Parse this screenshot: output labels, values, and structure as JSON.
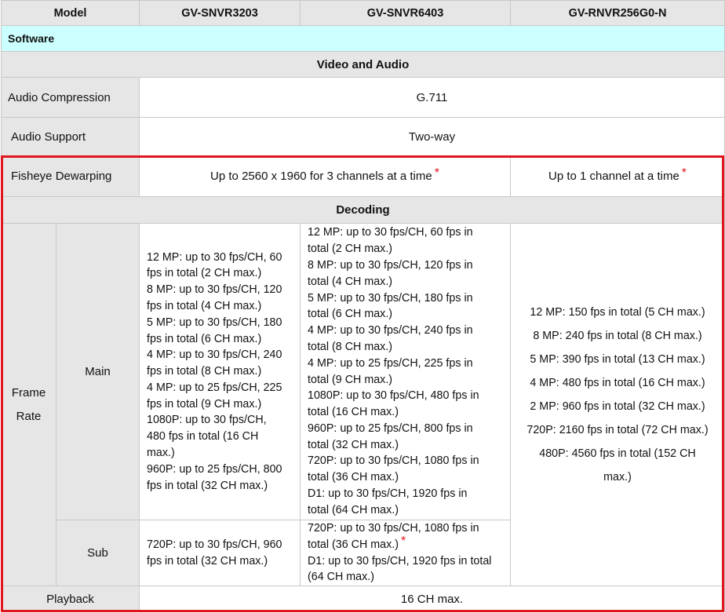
{
  "header": {
    "model": "Model",
    "col1": "GV-SNVR3203",
    "col2": "GV-SNVR6403",
    "col3": "GV-RNVR256G0-N"
  },
  "software": "Software",
  "video_audio": "Video and Audio",
  "audio_compression": {
    "label": "Audio Compression",
    "value": "G.711"
  },
  "audio_support": {
    "label": "Audio Support",
    "value": "Two-way"
  },
  "fisheye": {
    "label": "Fisheye Dewarping",
    "value_12": "Up to 2560 x 1960 for 3 channels at a time",
    "value_3": "Up to 1 channel at a time",
    "mark": "*"
  },
  "decoding": "Decoding",
  "frame_rate": {
    "label_1": "Frame",
    "label_2": "Rate",
    "main_label": "Main",
    "sub_label": "Sub",
    "main_col1": [
      "12 MP: up to 30 fps/CH, 60",
      "fps in total (2 CH max.)",
      "8 MP: up to 30 fps/CH, 120",
      "fps in total (4 CH max.)",
      "5 MP: up to 30 fps/CH, 180",
      "fps in total (6 CH max.)",
      "4 MP: up to 30 fps/CH, 240",
      "fps in total (8 CH max.)",
      "4 MP: up to 25 fps/CH, 225",
      "fps in total (9 CH max.)",
      "1080P: up to 30 fps/CH,",
      "480 fps in total (16 CH",
      "max.)",
      "960P: up to 25 fps/CH, 800",
      "fps in total (32 CH max.)"
    ],
    "main_col2": [
      "12 MP: up to 30 fps/CH, 60 fps in",
      "total (2 CH max.)",
      "8 MP: up to 30 fps/CH, 120 fps in",
      "total (4 CH max.)",
      "5 MP: up to 30 fps/CH, 180 fps in",
      "total (6 CH max.)",
      "4 MP: up to 30 fps/CH, 240 fps in",
      "total (8 CH max.)",
      "4 MP: up to 25 fps/CH, 225 fps in",
      "total (9 CH max.)",
      "1080P: up to 30 fps/CH, 480 fps in",
      "total (16 CH max.)",
      "960P: up to 25 fps/CH, 800 fps in",
      "total (32 CH max.)",
      "720P: up to 30 fps/CH, 1080 fps in",
      "total (36 CH max.)",
      "D1: up to 30 fps/CH, 1920 fps in",
      "total (64 CH max.)"
    ],
    "col3": [
      "12 MP: 150 fps in total (5 CH max.)",
      "8 MP: 240 fps in total (8 CH max.)",
      "5 MP: 390 fps in total (13 CH max.)",
      "4 MP: 480 fps in total (16 CH max.)",
      "2 MP: 960 fps in total (32 CH max.)",
      "720P: 2160 fps in total (72 CH max.)",
      "480P: 4560 fps in total (152 CH",
      "max.)"
    ],
    "sub_col1": [
      "720P: up to 30 fps/CH, 960",
      "fps in total (32 CH max.)"
    ],
    "sub_col2": [
      "720P: up to 30 fps/CH, 1080 fps in",
      "total (36 CH max.)",
      "D1: up to 30 fps/CH, 1920 fps in total",
      "(64 CH max.)"
    ]
  },
  "playback": {
    "label": "Playback",
    "value": "16 CH max."
  },
  "colors": {
    "highlight_border": "#e0161e",
    "software_bg": "#ccffff",
    "header_bg": "#e6e6e6"
  }
}
